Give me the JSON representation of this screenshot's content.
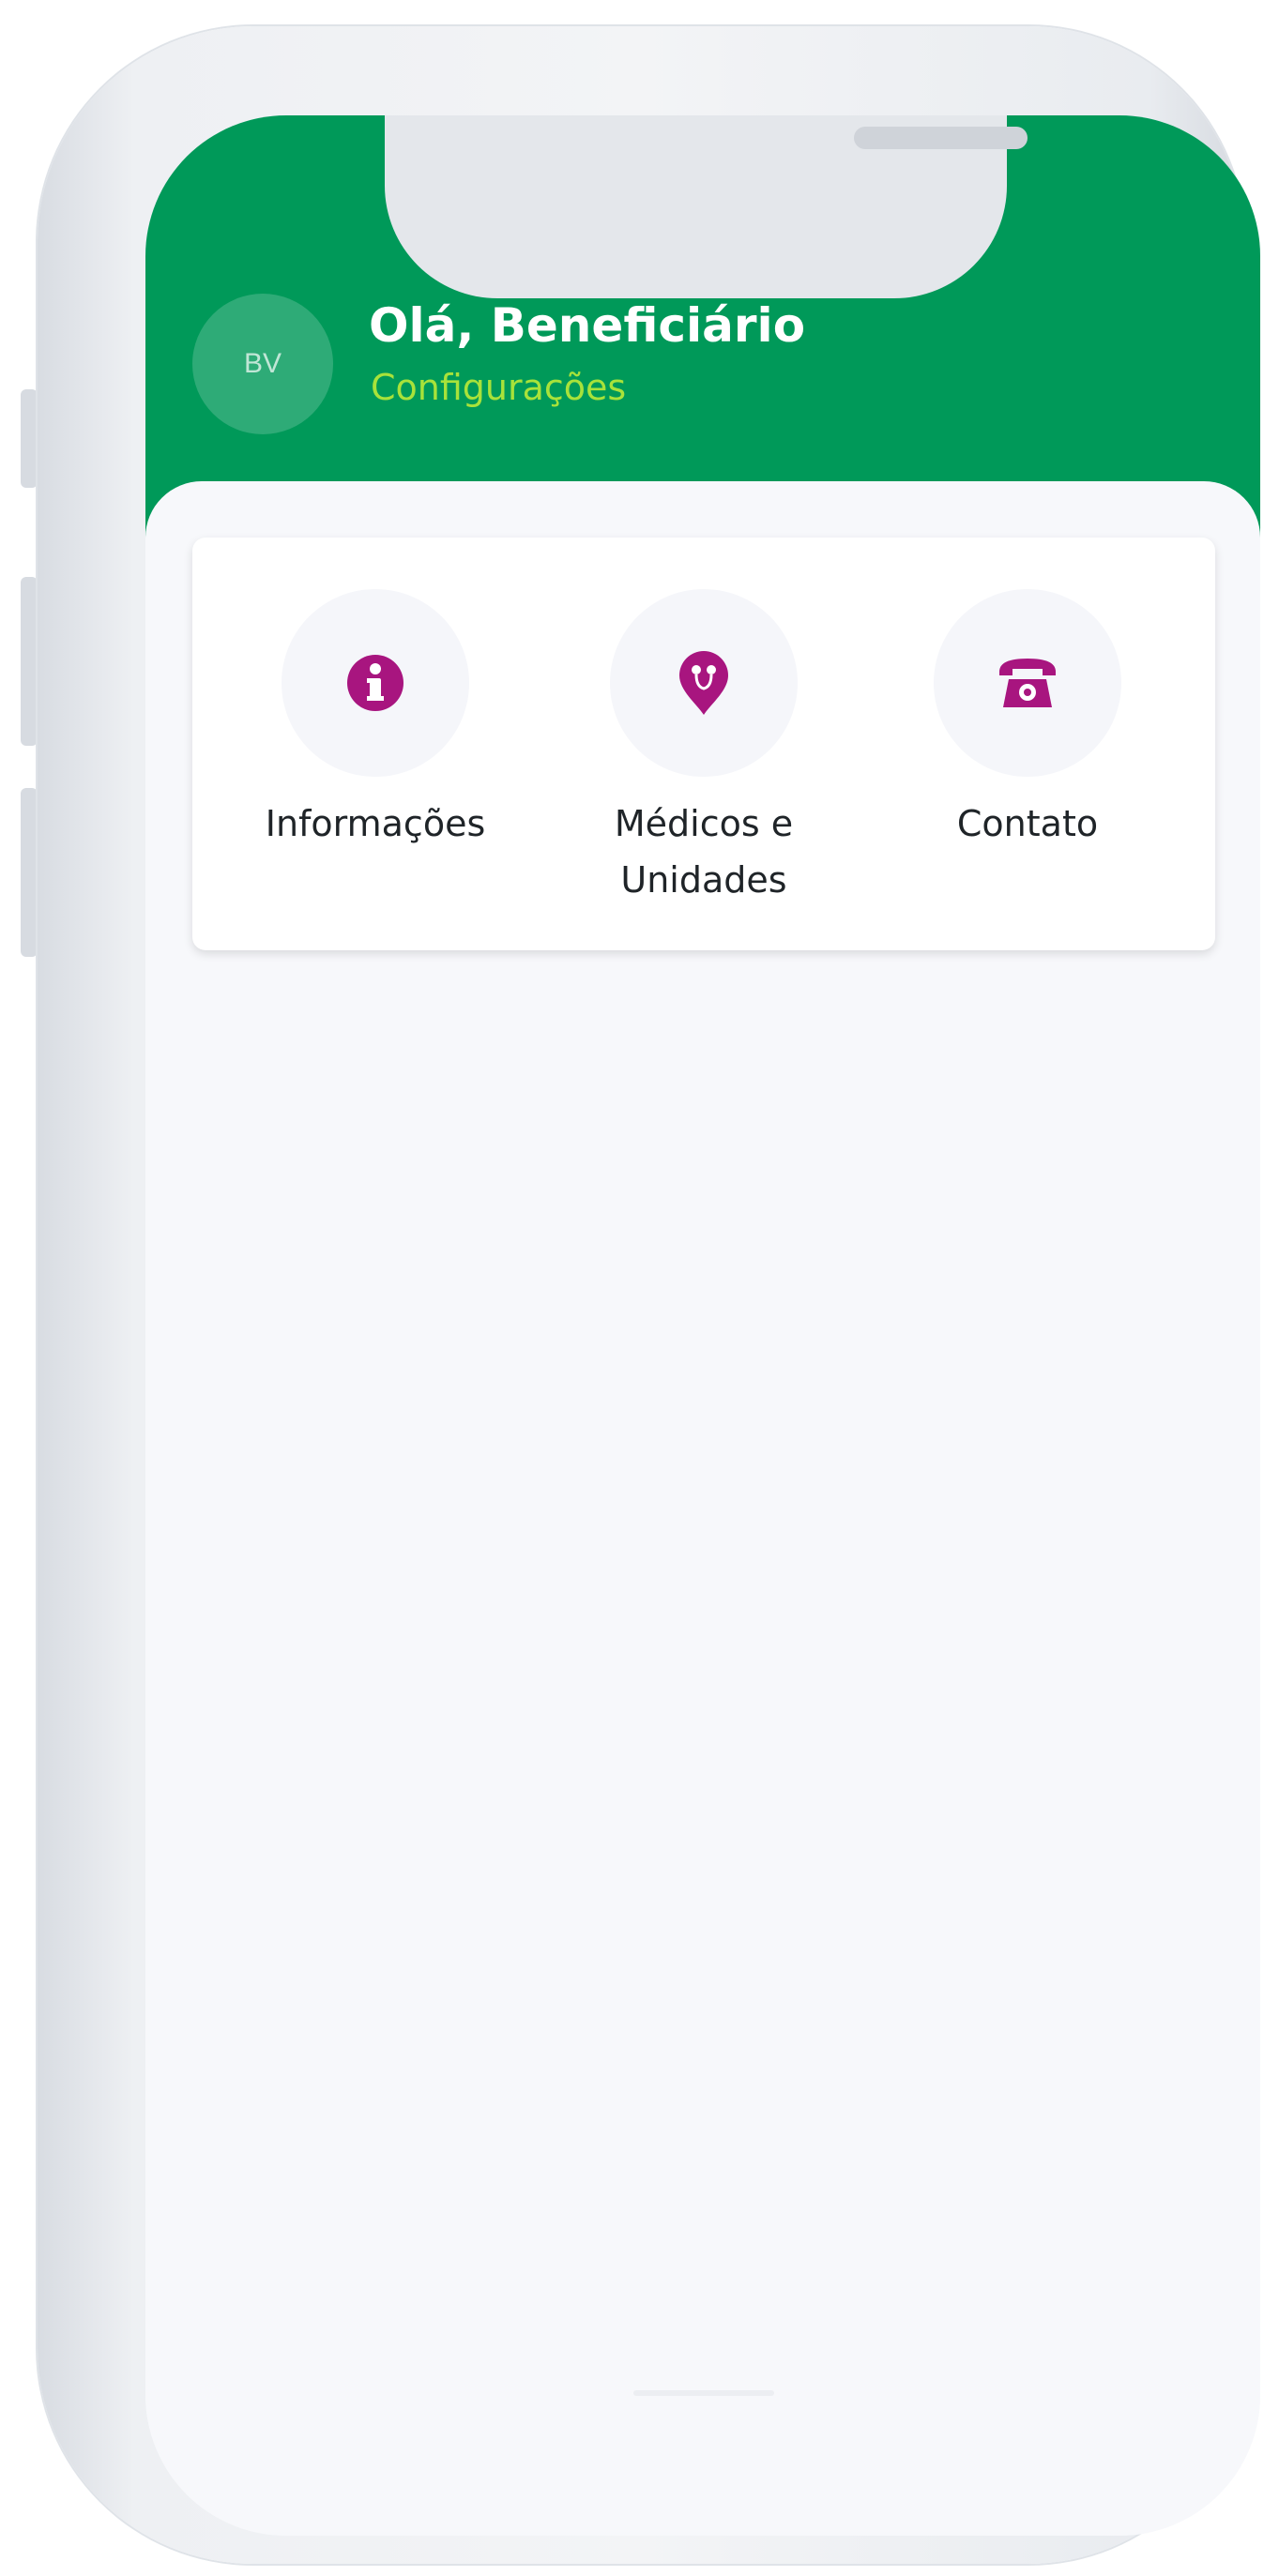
{
  "header": {
    "avatar_initials": "BV",
    "greeting": "Olá, Beneficiário",
    "settings_label": "Configurações"
  },
  "actions": [
    {
      "label": "Informações",
      "icon": "info-icon"
    },
    {
      "label": "Médicos e\nUnidades",
      "icon": "location-pin-icon"
    },
    {
      "label": "Contato",
      "icon": "telephone-icon"
    }
  ],
  "colors": {
    "brand_green": "#009959",
    "accent_lime": "#a8e23a",
    "icon_magenta": "#a8157f",
    "screen_bg": "#f7f8fb"
  }
}
